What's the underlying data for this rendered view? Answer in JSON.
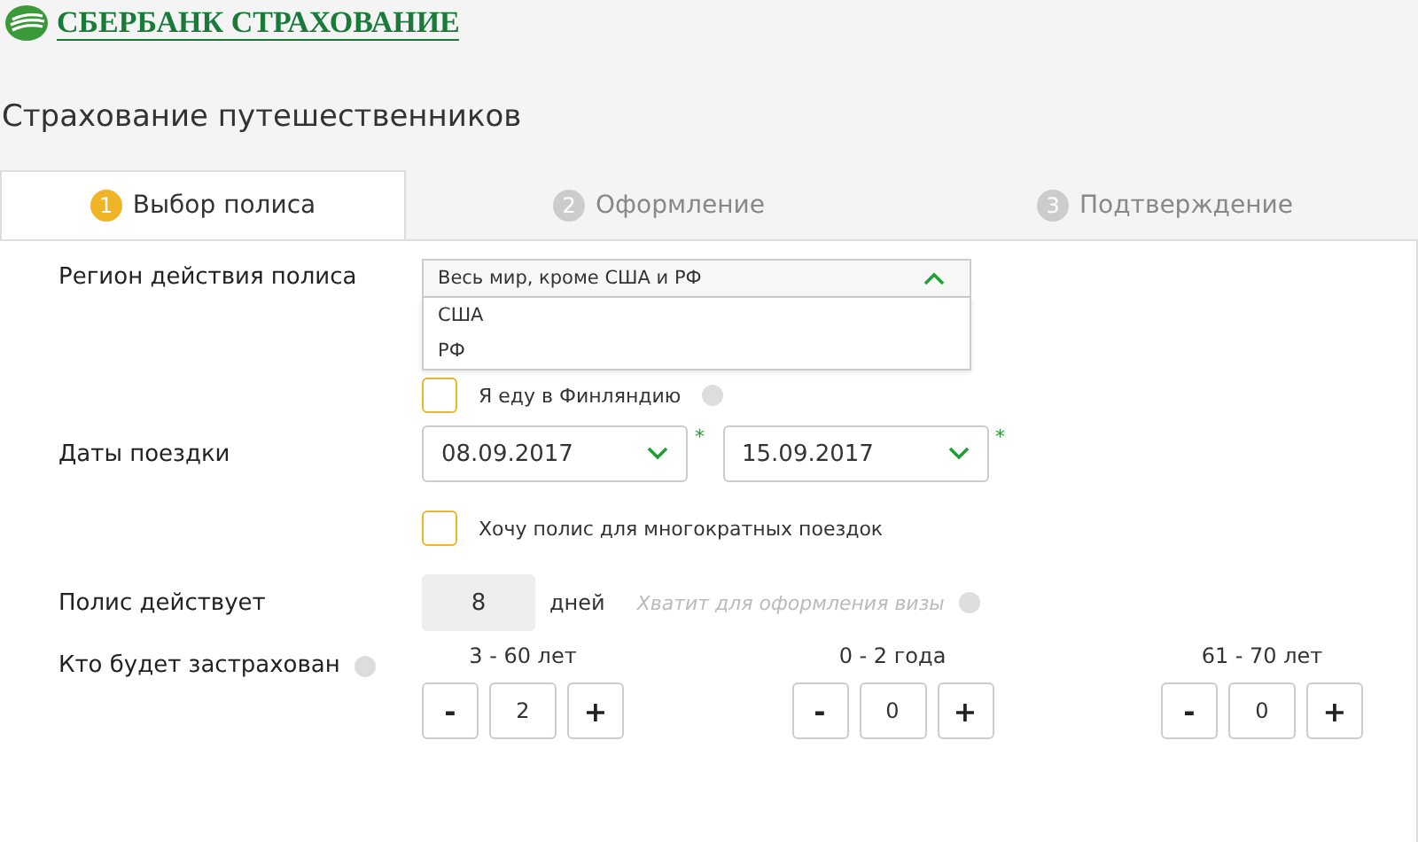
{
  "logo": {
    "text": "СБЕРБАНК СТРАХОВАНИЕ"
  },
  "page_title": "Страхование путешественников",
  "tabs": [
    {
      "number": "1",
      "label": "Выбор полиса",
      "selected": true
    },
    {
      "number": "2",
      "label": "Оформление",
      "selected": false
    },
    {
      "number": "3",
      "label": "Подтверждение",
      "selected": false
    }
  ],
  "region": {
    "label": "Регион действия полиса",
    "value": "Весь мир, кроме США и РФ",
    "expanded": true,
    "options": [
      "США",
      "РФ"
    ]
  },
  "finland": {
    "label": "Я еду в Финляндию",
    "checked": false
  },
  "dates": {
    "label": "Даты поездки",
    "from": "08.09.2017",
    "to": "15.09.2017",
    "required_mark": "*"
  },
  "multi": {
    "label": "Хочу полис для многократных поездок",
    "checked": false
  },
  "duration": {
    "label": "Полис действует",
    "value": "8",
    "unit": "дней",
    "hint": "Хватит для оформления визы"
  },
  "insured": {
    "label": "Кто будет застрахован",
    "minus": "-",
    "plus": "+",
    "groups": [
      {
        "label": "3 - 60 лет",
        "count": "2"
      },
      {
        "label": "0 - 2 года",
        "count": "0"
      },
      {
        "label": "61 - 70 лет",
        "count": "0"
      }
    ]
  }
}
